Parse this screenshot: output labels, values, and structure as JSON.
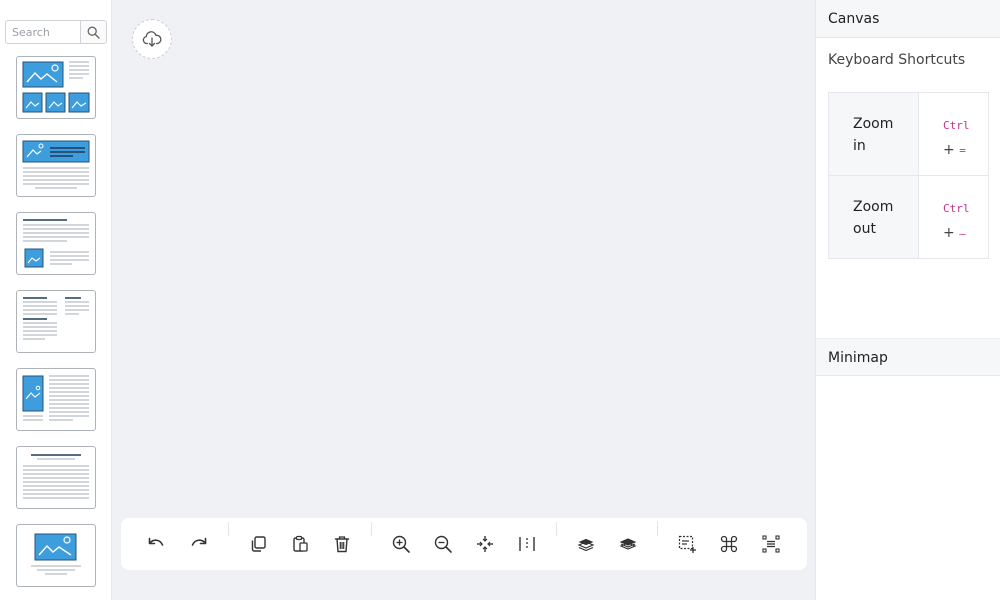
{
  "sidebar": {
    "search": {
      "placeholder": "Search"
    },
    "templates": [
      {
        "name": "gallery-template"
      },
      {
        "name": "banner-text-template"
      },
      {
        "name": "article-image-template"
      },
      {
        "name": "two-column-template"
      },
      {
        "name": "side-image-template"
      },
      {
        "name": "text-only-template"
      },
      {
        "name": "centered-image-template"
      }
    ]
  },
  "toolbar": {
    "tools": [
      "undo",
      "redo",
      "copy",
      "paste",
      "delete",
      "zoom-in",
      "zoom-out",
      "fit",
      "align",
      "group-back",
      "group-front",
      "select-area",
      "command",
      "distribute"
    ]
  },
  "right_panel": {
    "canvas_title": "Canvas",
    "shortcuts_title": "Keyboard Shortcuts",
    "shortcuts": [
      {
        "name_line1": "Zoom",
        "name_line2": "in",
        "key_mod": "Ctrl",
        "plus": "+",
        "key": "="
      },
      {
        "name_line1": "Zoom",
        "name_line2": "out",
        "key_mod": "Ctrl",
        "plus": "+",
        "key": "–"
      }
    ],
    "minimap_title": "Minimap"
  },
  "colors": {
    "accent_blue": "#3d9ddd",
    "shortcut_key": "#c0348c",
    "canvas_bg": "#f0f1f5"
  }
}
